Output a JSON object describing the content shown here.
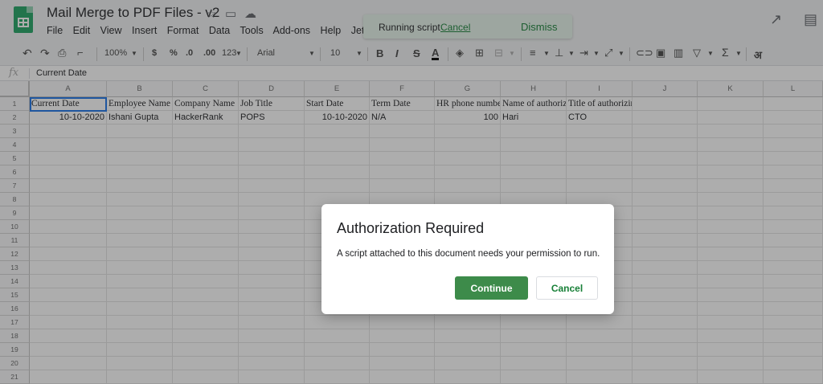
{
  "document": {
    "title": "Mail Merge to PDF Files - v2"
  },
  "menu": [
    "File",
    "Edit",
    "View",
    "Insert",
    "Format",
    "Data",
    "Tools",
    "Add-ons",
    "Help",
    "JetPack"
  ],
  "toast": {
    "message": "Running script",
    "cancel": "Cancel",
    "dismiss": "Dismiss"
  },
  "toolbar": {
    "zoom": "100%",
    "currency": "$",
    "percent": "%",
    "dec_decrease": ".0",
    "dec_increase": ".00",
    "more_formats": "123",
    "font": "Arial",
    "font_size": "10",
    "bold": "B",
    "italic": "I",
    "strike": "S",
    "text_color": "A",
    "input_tool": "अ"
  },
  "formula_bar": {
    "fx": "fx",
    "value": "Current Date"
  },
  "columns": [
    "A",
    "B",
    "C",
    "D",
    "E",
    "F",
    "G",
    "H",
    "I",
    "J",
    "K",
    "L"
  ],
  "rows": [
    "1",
    "2",
    "3",
    "4",
    "5",
    "6",
    "7",
    "8",
    "9",
    "10",
    "11",
    "12",
    "13",
    "14",
    "15",
    "16",
    "17",
    "18",
    "19",
    "20",
    "21"
  ],
  "header_row": [
    "Current Date",
    "Employee Name",
    "Company Name",
    "Job Title",
    "Start Date",
    "Term Date",
    "HR phone numbe",
    "Name of authoriz",
    "Title of authorizing person"
  ],
  "data_row": [
    "10-10-2020",
    "Ishani Gupta",
    "HackerRank",
    "POPS",
    "10-10-2020",
    "N/A",
    "100",
    "Hari",
    "CTO"
  ],
  "dialog": {
    "title": "Authorization Required",
    "body": "A script attached to this document needs your permission to run.",
    "continue": "Continue",
    "cancel": "Cancel"
  },
  "colors": {
    "accent": "#188038",
    "continue_button": "#3d8b4a",
    "toast_bg": "#e6f4ea",
    "selection": "#1a73e8"
  }
}
